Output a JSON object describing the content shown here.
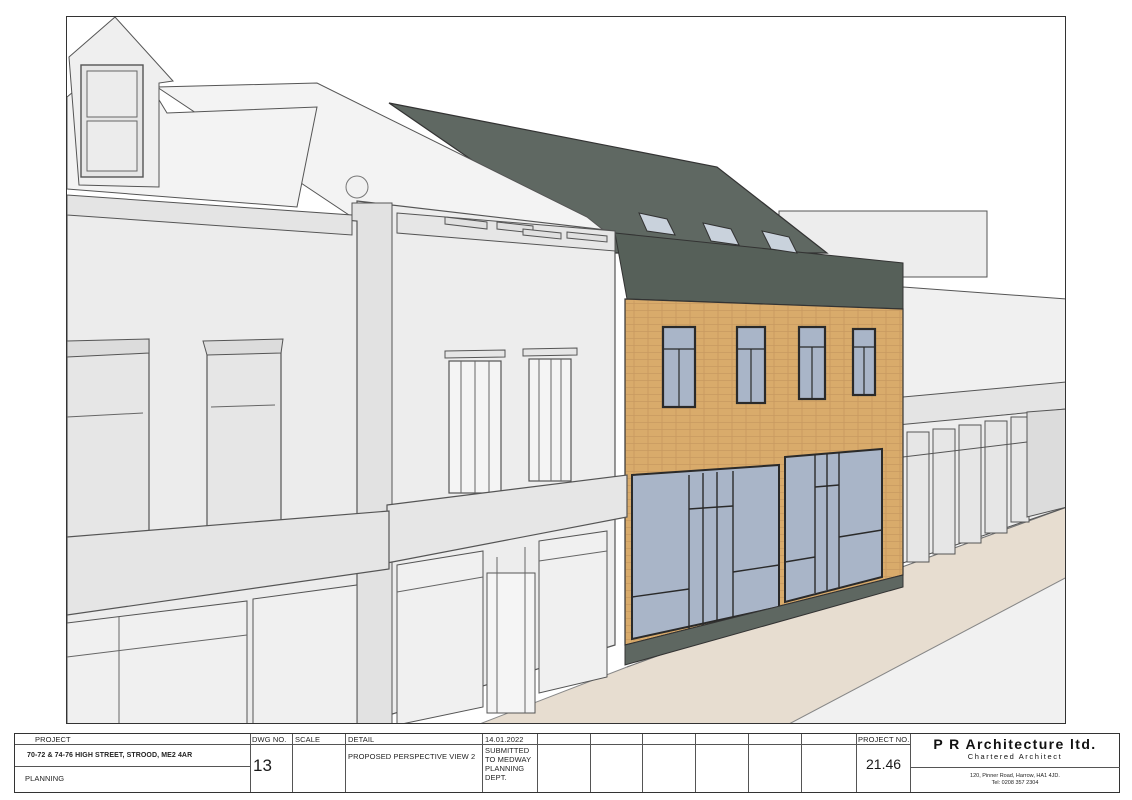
{
  "title_block": {
    "project_label": "PROJECT",
    "project_address": "70-72 & 74-76 HIGH STREET, STROOD, ME2 4AR",
    "stage": "PLANNING",
    "dwg_no_label": "DWG NO.",
    "dwg_no": "13",
    "scale_label": "SCALE",
    "scale_value": "",
    "detail_label": "DETAIL",
    "detail_value": "PROPOSED PERSPECTIVE VIEW 2",
    "revision_date": "14.01.2022",
    "revision_note": "SUBMITTED TO MEDWAY PLANNING DEPT.",
    "project_no_label": "PROJECT NO.",
    "project_no": "21.46"
  },
  "firm": {
    "name": "P R Architecture ltd.",
    "subtitle": "Chartered Architect",
    "address": "120, Pinner Road, Harrow, HA1 4JD.",
    "phone": "Tel: 0208 357 2304"
  },
  "colors": {
    "brick": "#d9ab6b",
    "roof": "#5f6862",
    "glazing": "#a9b5c8",
    "existing_building": "#ececec",
    "pavement": "#e7ddd0"
  }
}
